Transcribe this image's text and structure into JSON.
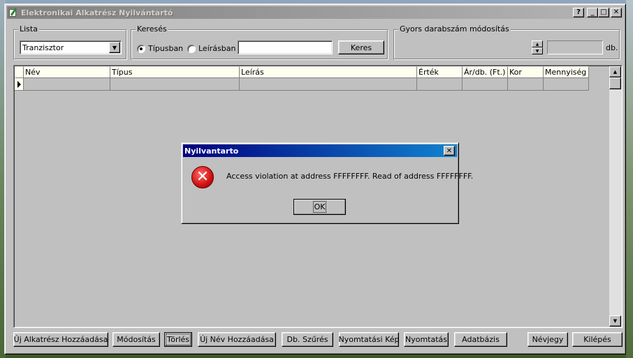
{
  "window": {
    "title": "Elektronikai Alkatrész Nyilvántartó",
    "buttons": {
      "help": "?",
      "minimize": "_",
      "maximize": "□",
      "close": "✕"
    }
  },
  "lista": {
    "label": "Lista",
    "selected": "Tranzisztor"
  },
  "kereses": {
    "label": "Keresés",
    "radio_tipus": "Típusban",
    "radio_leiras": "Leírásban",
    "selected": "Típusban",
    "query": "",
    "button": "Keres"
  },
  "gyors": {
    "label": "Gyors darabszám módosítás",
    "value": "",
    "unit": "db."
  },
  "grid": {
    "columns": [
      "Név",
      "Típus",
      "Leírás",
      "Érték",
      "Ár/db.   (Ft.)",
      "Kor",
      "Mennyiség"
    ]
  },
  "dialog": {
    "title": "Nyilvantarto",
    "message": "Access violation at address FFFFFFFF. Read of address FFFFFFFF.",
    "ok": "OK"
  },
  "toolbar": {
    "uj_alkatresz": "Új Alkatrész Hozzáadása",
    "modositas": "Módosítás",
    "torles": "Törlés",
    "uj_nev": "Új Név Hozzáadása",
    "db_szures": "Db. Szűrés",
    "nyomtatasi_kep": "Nyomtatási Kép",
    "nyomtatas": "Nyomtatás",
    "adatbazis": "Adatbázis",
    "nevjegy": "Névjegy",
    "kilepes": "Kilépés"
  },
  "colors": {
    "face": "#c0c0c0",
    "title_active": "#000080",
    "title_inactive": "#808080",
    "grid_header": "#fffff0"
  }
}
